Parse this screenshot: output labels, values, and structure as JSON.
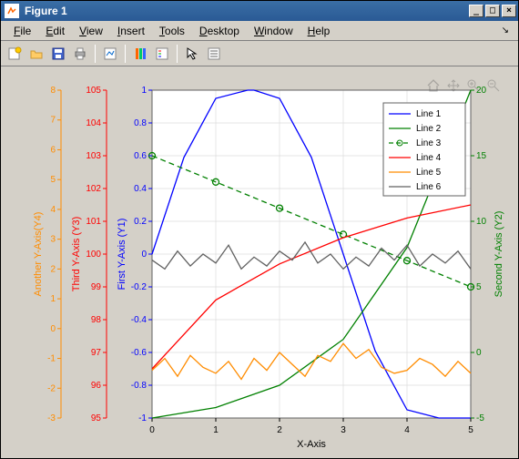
{
  "window": {
    "title": "Figure 1"
  },
  "menubar": {
    "items": [
      "File",
      "Edit",
      "View",
      "Insert",
      "Tools",
      "Desktop",
      "Window",
      "Help"
    ]
  },
  "toolbar": {
    "icons": [
      "new-figure",
      "open",
      "save",
      "print",
      "link",
      "color-tool",
      "legend-tool",
      "pointer",
      "text-tool"
    ]
  },
  "figure_toolbar": {
    "icons": [
      "home",
      "pan",
      "zoom-in",
      "zoom-out"
    ]
  },
  "chart_data": {
    "type": "line",
    "xlabel": "X-Axis",
    "x_range": [
      0,
      5
    ],
    "x_ticks": [
      0,
      1,
      2,
      3,
      4,
      5
    ],
    "axes": [
      {
        "label": "First Y-Axis (Y1)",
        "color": "#0000ff",
        "range": [
          -1,
          1
        ],
        "ticks": [
          -1,
          -0.8,
          -0.6,
          -0.4,
          -0.2,
          0,
          0.2,
          0.4,
          0.6,
          0.8,
          1
        ]
      },
      {
        "label": "Second Y-Axis (Y2)",
        "color": "#008000",
        "range": [
          -5,
          20
        ],
        "ticks": [
          -5,
          0,
          5,
          10,
          15,
          20
        ]
      },
      {
        "label": "Third Y-Axis (Y3)",
        "color": "#ff0000",
        "range": [
          95,
          105
        ],
        "ticks": [
          95,
          96,
          97,
          98,
          99,
          100,
          101,
          102,
          103,
          104,
          105
        ]
      },
      {
        "label": "Another Y-Axis(Y4)",
        "color": "#ff8c00",
        "range": [
          -3,
          8
        ],
        "ticks": [
          -3,
          -2,
          -1,
          0,
          1,
          2,
          3,
          4,
          5,
          6,
          7,
          8
        ]
      }
    ],
    "legend": {
      "entries": [
        "Line 1",
        "Line 2",
        "Line 3",
        "Line 4",
        "Line 5",
        "Line 6"
      ]
    },
    "series": [
      {
        "name": "Line 1",
        "axis": 0,
        "color": "#0000ff",
        "style": "solid",
        "markers": false,
        "desc": "sin(pi*x/5 * 2) → sine starting 0, peak 1 at x≈1.6, ends -1 at x=5",
        "x": [
          0,
          0.5,
          1,
          1.5,
          1.6,
          2,
          2.5,
          3,
          3.5,
          4,
          4.5,
          5
        ],
        "y": [
          0,
          0.59,
          0.95,
          1.0,
          1.0,
          0.95,
          0.59,
          0,
          -0.59,
          -0.95,
          -1.0,
          -1.0
        ]
      },
      {
        "name": "Line 2",
        "axis": 1,
        "color": "#008000",
        "style": "solid",
        "markers": false,
        "desc": "exp-ish curve from -5 at x=0 to 20 at x=5",
        "x": [
          0,
          1,
          2,
          3,
          4,
          5
        ],
        "y": [
          -5,
          -4.2,
          -2.5,
          1,
          8,
          20
        ]
      },
      {
        "name": "Line 3",
        "axis": 1,
        "color": "#008000",
        "style": "dashed",
        "markers": true,
        "desc": "linear descending from ~15 to ~5",
        "x": [
          0,
          1,
          2,
          3,
          4,
          5
        ],
        "y": [
          15,
          13,
          11,
          9,
          7,
          5
        ]
      },
      {
        "name": "Line 4",
        "axis": 2,
        "color": "#ff0000",
        "style": "solid",
        "markers": false,
        "desc": "monotone rising 96.5→101.5 with curvature",
        "x": [
          0,
          1,
          2,
          3,
          4,
          5
        ],
        "y": [
          96.5,
          98.6,
          99.7,
          100.5,
          101.1,
          101.5
        ]
      },
      {
        "name": "Line 5",
        "axis": 3,
        "color": "#ff8c00",
        "style": "solid",
        "markers": false,
        "desc": "noisy random around -1.2±1",
        "x": [
          0,
          0.2,
          0.4,
          0.6,
          0.8,
          1,
          1.2,
          1.4,
          1.6,
          1.8,
          2,
          2.2,
          2.4,
          2.6,
          2.8,
          3,
          3.2,
          3.4,
          3.6,
          3.8,
          4,
          4.2,
          4.4,
          4.6,
          4.8,
          5
        ],
        "y": [
          -1.4,
          -1.0,
          -1.6,
          -0.9,
          -1.3,
          -1.5,
          -1.1,
          -1.7,
          -1.0,
          -1.4,
          -0.8,
          -1.2,
          -1.6,
          -0.9,
          -1.1,
          -0.5,
          -1.0,
          -0.7,
          -1.3,
          -1.5,
          -1.4,
          -1.0,
          -1.2,
          -1.6,
          -1.1,
          -1.5
        ]
      },
      {
        "name": "Line 6",
        "axis": 3,
        "color": "#606060",
        "style": "solid",
        "markers": false,
        "desc": "noisy random around 2.3±0.7",
        "x": [
          0,
          0.2,
          0.4,
          0.6,
          0.8,
          1,
          1.2,
          1.4,
          1.6,
          1.8,
          2,
          2.2,
          2.4,
          2.6,
          2.8,
          3,
          3.2,
          3.4,
          3.6,
          3.8,
          4,
          4.2,
          4.4,
          4.6,
          4.8,
          5
        ],
        "y": [
          2.3,
          2.0,
          2.6,
          2.1,
          2.5,
          2.2,
          2.8,
          2.0,
          2.4,
          2.1,
          2.6,
          2.3,
          2.9,
          2.2,
          2.5,
          2.0,
          2.4,
          2.1,
          2.7,
          2.3,
          2.8,
          2.1,
          2.5,
          2.2,
          2.6,
          2.0
        ]
      }
    ]
  }
}
